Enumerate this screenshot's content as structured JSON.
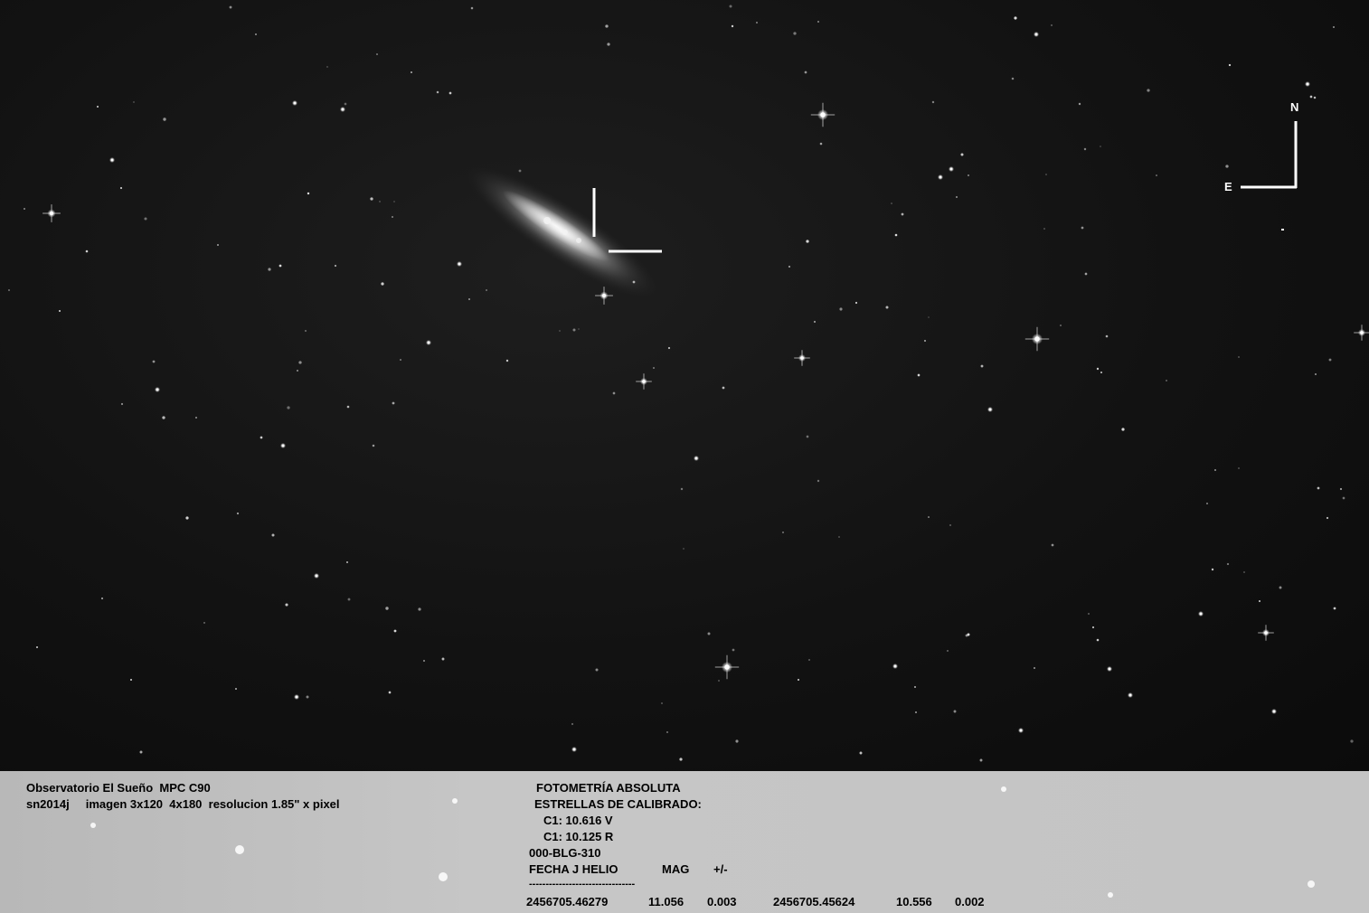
{
  "compass": {
    "north": "N",
    "east": "E"
  },
  "footer": {
    "observatory": "Observatorio El Sueño  MPC C90",
    "image_info": "sn2014j     imagen 3x120  4x180  resolucion 1.85\" x pixel",
    "photometry_title": "FOTOMETRÍA ABSOLUTA",
    "calibration_title": "ESTRELLAS DE CALIBRADO:",
    "c1_v": "C1: 10.616 V",
    "c1_r": "C1: 10.125 R",
    "sequence": "000-BLG-310",
    "col_date": "FECHA J HELIO",
    "col_mag": "MAG",
    "col_err": "+/-",
    "separator": "--------------------------------",
    "row1": {
      "date": "2456705.46279",
      "mag": "11.056",
      "err": "0.003"
    },
    "row2": {
      "date": "2456705.45624",
      "mag": "10.556",
      "err": "0.002"
    }
  }
}
